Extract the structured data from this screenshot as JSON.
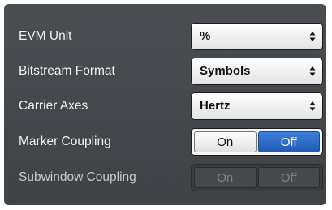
{
  "settings": {
    "evm_unit": {
      "label": "EVM Unit",
      "value": "%"
    },
    "bitstream_format": {
      "label": "Bitstream Format",
      "value": "Symbols"
    },
    "carrier_axes": {
      "label": "Carrier Axes",
      "value": "Hertz"
    },
    "marker_coupling": {
      "label": "Marker Coupling",
      "on_label": "On",
      "off_label": "Off",
      "selected": "Off"
    },
    "subwindow_coupling": {
      "label": "Subwindow Coupling",
      "on_label": "On",
      "off_label": "Off",
      "enabled": false
    }
  },
  "colors": {
    "panel_bg": "#45494d",
    "selected_toggle": "#2a6ac8",
    "disabled_text": "#7e8184"
  }
}
